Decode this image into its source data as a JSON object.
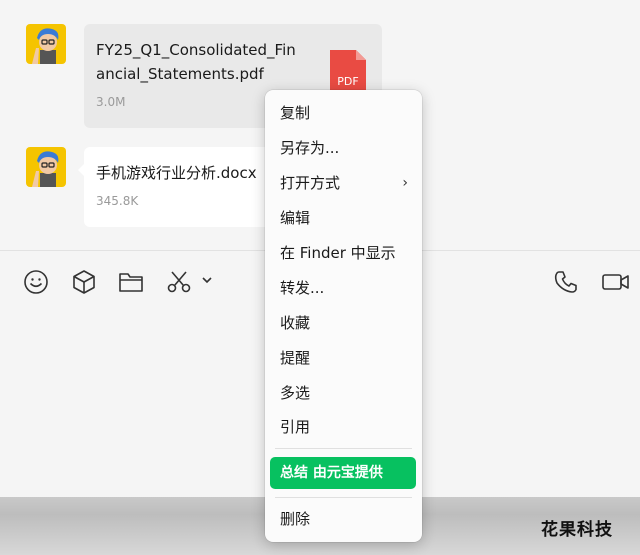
{
  "messages": [
    {
      "file_name_line1": "FY25_Q1_Consolidated_Fin",
      "file_name_line2": "ancial_Statements.pdf",
      "size": "3.0M",
      "file_icon_label": "PDF"
    },
    {
      "file_name_line1": "手机游戏行业分析.docx",
      "size": "345.8K"
    }
  ],
  "toolbar": {
    "icons": [
      "emoji-icon",
      "box-icon",
      "folder-icon",
      "scissors-icon",
      "chevron-down-icon",
      "phone-icon",
      "video-icon"
    ]
  },
  "context_menu": {
    "copy": "复制",
    "save_as": "另存为...",
    "open_with": "打开方式",
    "open_with_chevron": "›",
    "edit": "编辑",
    "show_in_finder": "在 Finder 中显示",
    "forward": "转发...",
    "favorite": "收藏",
    "remind": "提醒",
    "multi_select": "多选",
    "quote": "引用",
    "summarize": "总结 由元宝提供",
    "delete": "删除"
  },
  "watermark": "花果科技",
  "colors": {
    "accent_green": "#07c160",
    "pdf_red": "#e94b43"
  }
}
